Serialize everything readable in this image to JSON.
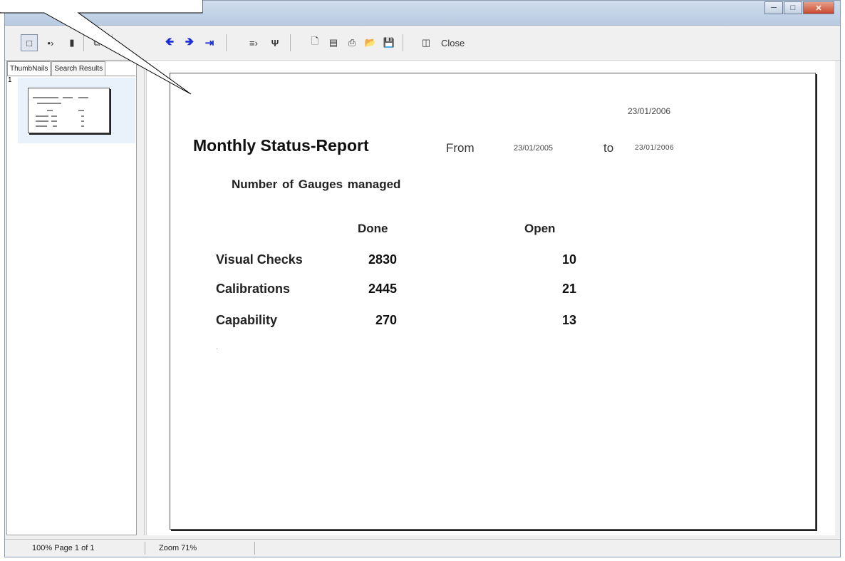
{
  "toolbar": {
    "close_label": "Close",
    "icons": [
      "single-page-icon",
      "two-pages-icon",
      "page-width-icon",
      "multi-page-icon",
      "first-page-icon",
      "previous-page-icon",
      "next-page-icon",
      "last-page-icon",
      "goto-page-icon",
      "find-icon",
      "new-page-icon",
      "export-icon",
      "print-icon",
      "open-icon",
      "save-icon",
      "exit-door-icon"
    ]
  },
  "left_panel": {
    "tabs": [
      "ThumbNails",
      "Search Results"
    ],
    "thumbnail_number": "1"
  },
  "report": {
    "print_date": "23/01/2006",
    "title": "Monthly Status-Report",
    "from_label": "From",
    "from_date": "23/01/2005",
    "to_label": "to",
    "to_date": "23/01/2006",
    "subtitle": "Number of Gauges  managed",
    "col_done": "Done",
    "col_open": "Open",
    "rows": [
      {
        "label": "Visual Checks",
        "done": "2830",
        "open": "10"
      },
      {
        "label": "Calibrations",
        "done": "2445",
        "open": "21"
      },
      {
        "label": "Capability",
        "done": "270",
        "open": "13"
      }
    ],
    "stray_mark": "."
  },
  "status": {
    "left": "100%  Page 1 of 1",
    "zoom": "Zoom 71%"
  },
  "colors": {
    "nav_arrow": "#1b2fd6",
    "thumb_highlight": "#e9f1fb"
  }
}
